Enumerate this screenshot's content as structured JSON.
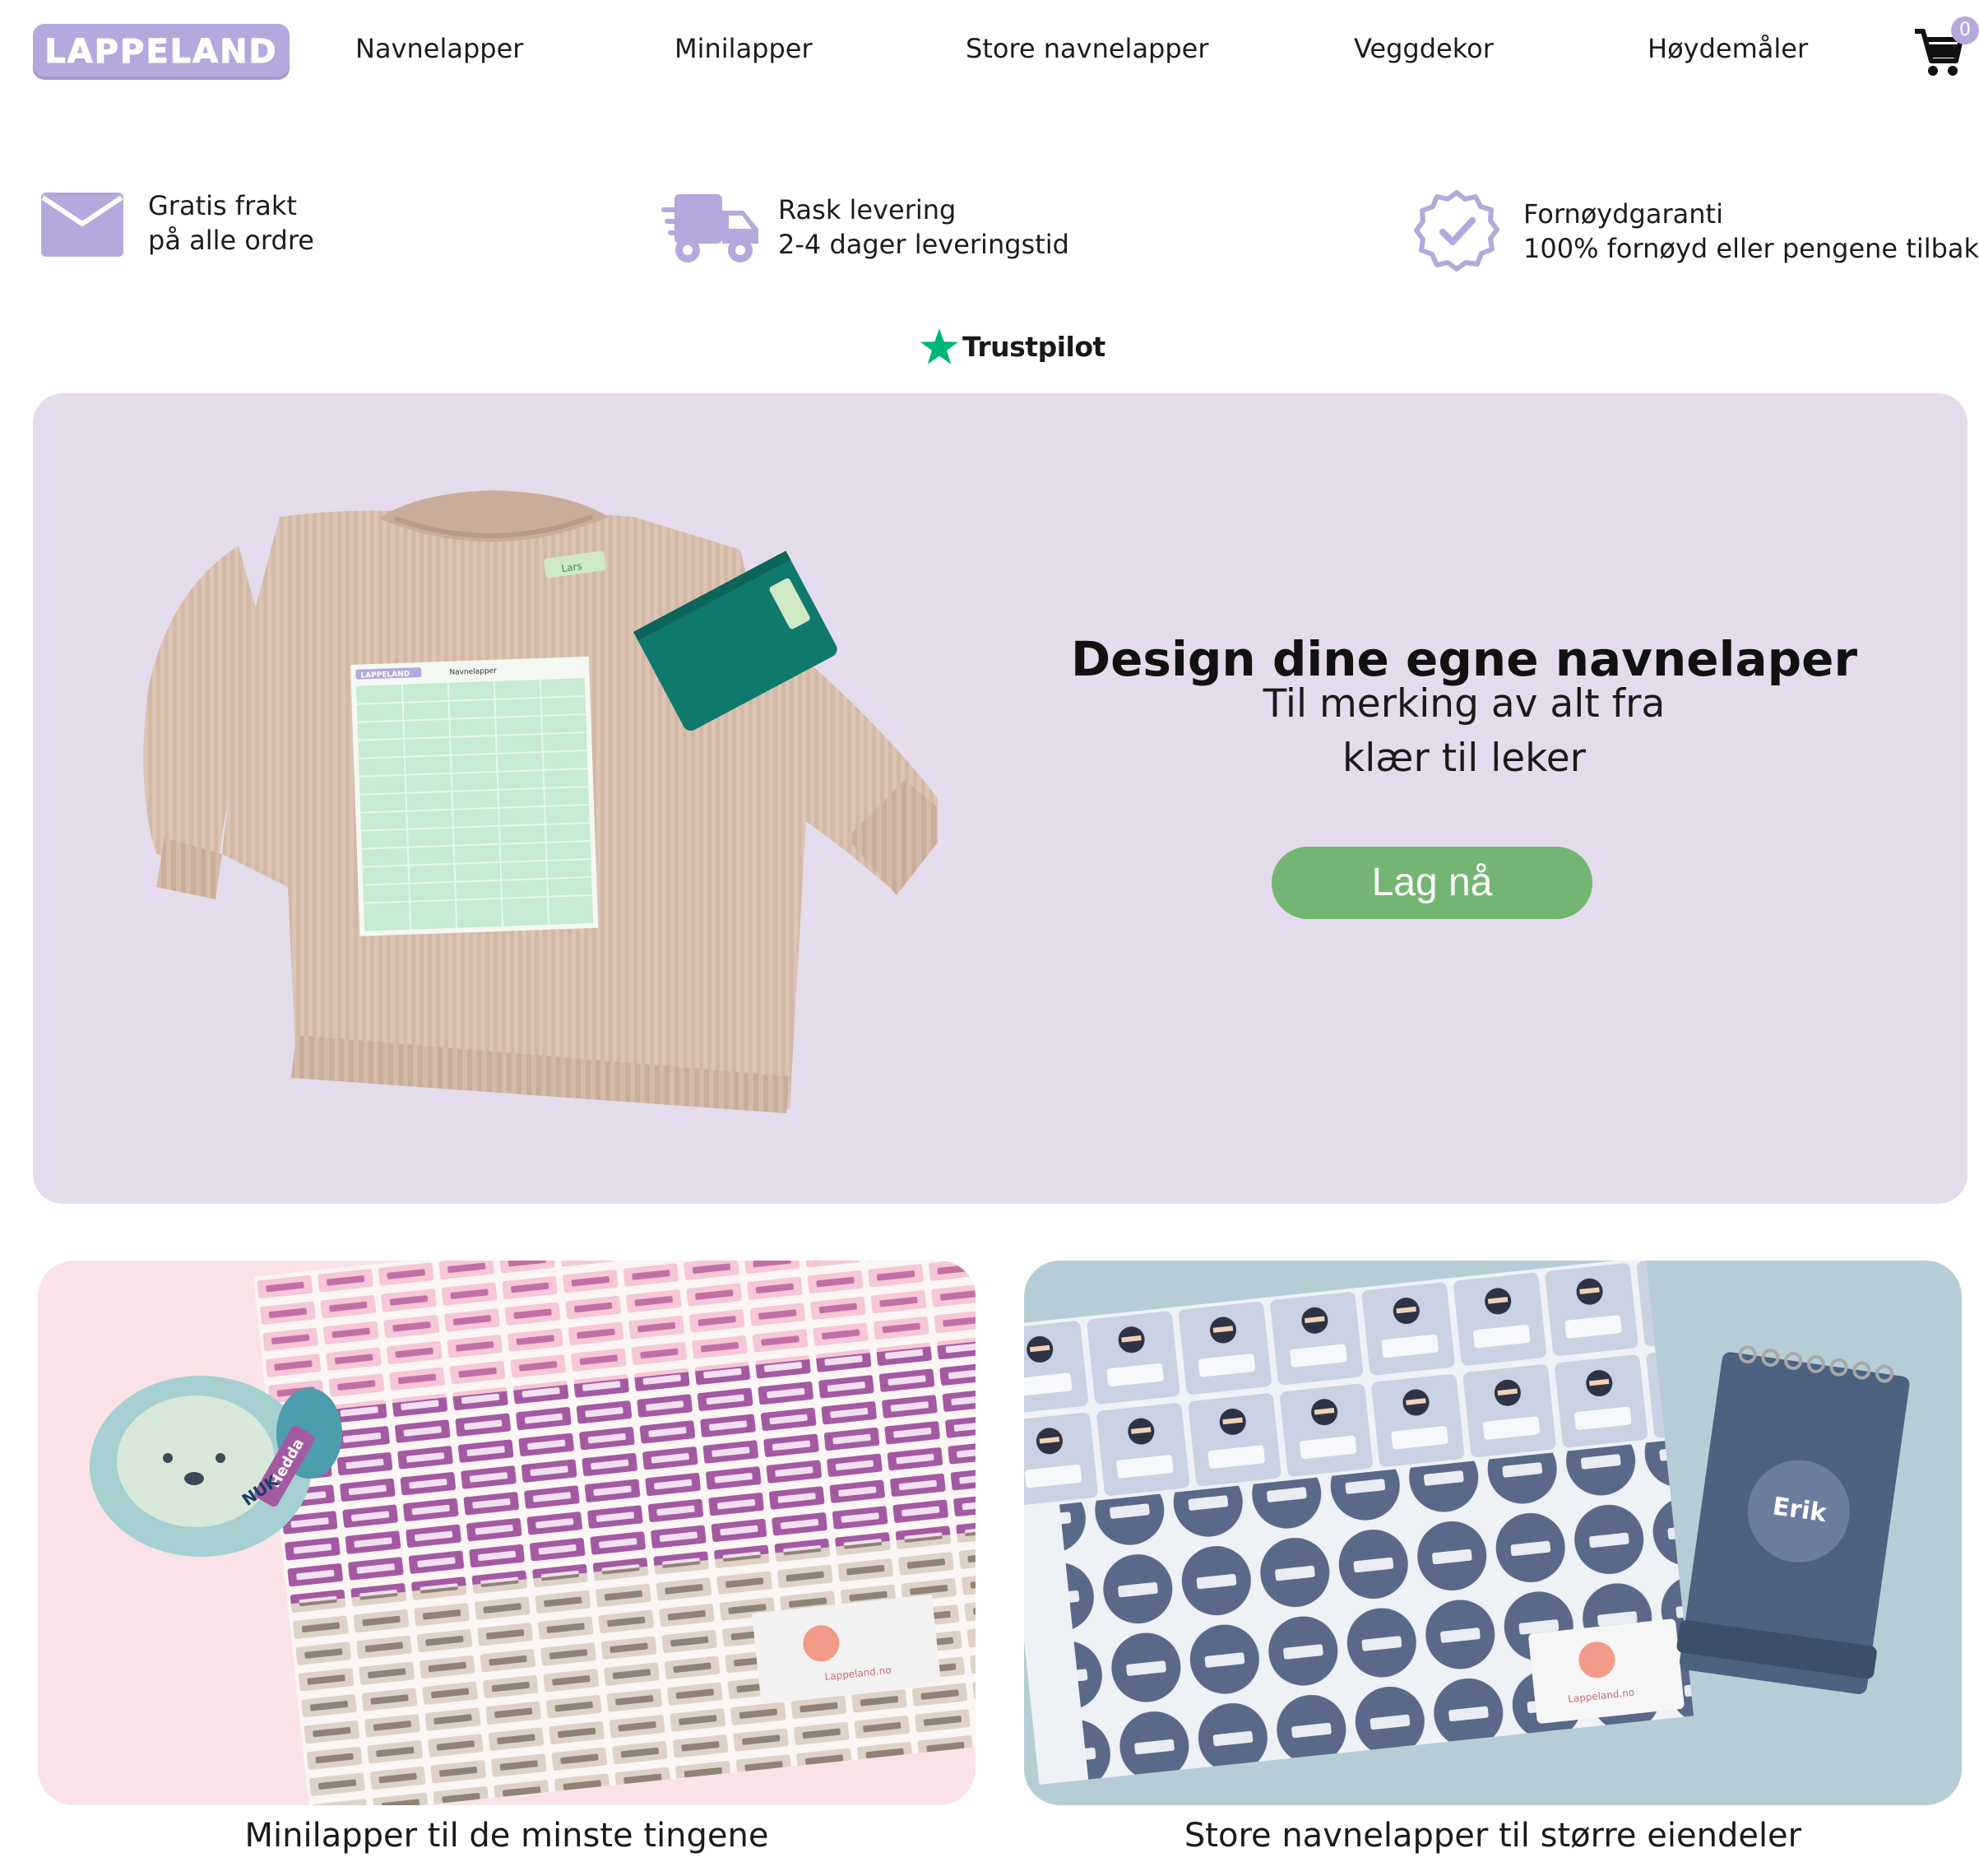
{
  "header": {
    "logo_text": "LAPPELAND",
    "nav": [
      "Navnelapper",
      "Minilapper",
      "Store navnelapper",
      "Veggdekor",
      "Høydemåler"
    ],
    "cart_count": "0"
  },
  "usps": [
    {
      "icon": "envelope-icon",
      "line1": "Gratis frakt",
      "line2": "på alle ordre"
    },
    {
      "icon": "delivery-truck-icon",
      "line1": "Rask levering",
      "line2": "2-4 dager leveringstid"
    },
    {
      "icon": "badge-check-icon",
      "line1": "Fornøydgaranti",
      "line2": "100% fornøyd eller pengene tilbake"
    }
  ],
  "trustpilot": {
    "label": "Trustpilot"
  },
  "hero": {
    "title": "Design dine egne navnelaper",
    "subtitle_line1": "Til merking av alt fra",
    "subtitle_line2": "klær til leker",
    "cta": "Lag nå",
    "sheet_name": "Lars",
    "sheet_logo": "LAPPELAND",
    "sheet_title": "Navnelapper"
  },
  "cards": [
    {
      "caption": "Minilapper til de minste tingene",
      "label_name": "Hedda",
      "brand_mark": "Lappeland.no",
      "pacifier_text": "NUK"
    },
    {
      "caption": "Store navnelapper til større eiendeler",
      "label_name": "Erik",
      "brand_mark": "Lappeland.no"
    }
  ],
  "colors": {
    "brand_purple": "#b5a8dc",
    "hero_bg": "#e4dcec",
    "cta_green": "#75b573",
    "trustpilot_green": "#00b67a",
    "card_pink": "#f9e3e8",
    "card_blue": "#b7cdd6"
  }
}
